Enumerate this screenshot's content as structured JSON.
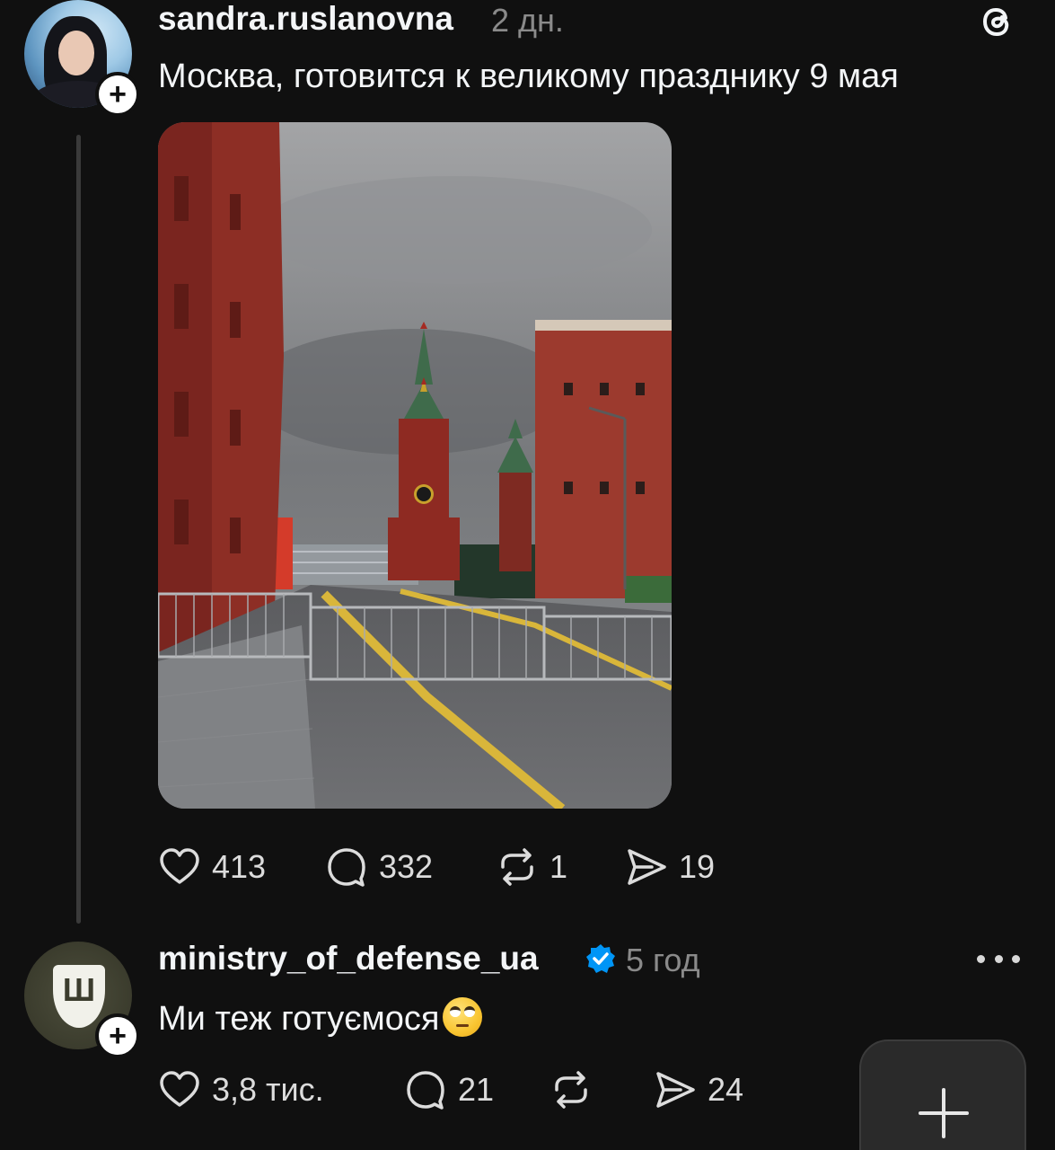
{
  "post": {
    "username": "sandra.ruslanovna",
    "time": "2 дн.",
    "text": "Москва, готовится к великому празднику 9 мая",
    "image_icon": "photo-red-square-kremlin",
    "likes": "413",
    "comments": "332",
    "reposts": "1",
    "shares": "19"
  },
  "reply": {
    "username": "ministry_of_defense_ua",
    "verified_icon": "verified-badge-icon",
    "time": "5 год",
    "text": "Ми теж готуємося",
    "emoji": "face-with-rolling-eyes",
    "likes": "3,8 тис.",
    "comments": "21",
    "reposts": "",
    "shares": "24"
  },
  "icons": {
    "app_logo": "threads-logo-icon",
    "more": "more-horizontal-icon",
    "fab": "plus-icon"
  },
  "colors": {
    "background": "#101010",
    "text": "#f3f5f7",
    "muted": "#8a8a8a",
    "verified": "#0095f6"
  }
}
